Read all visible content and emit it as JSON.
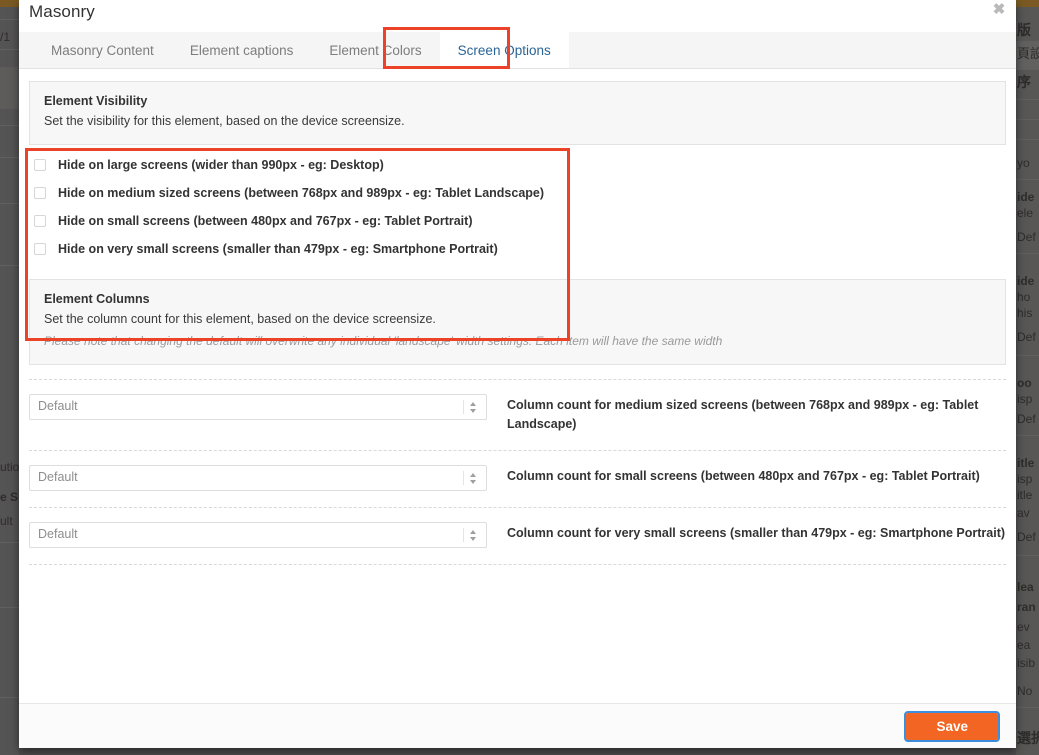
{
  "backdrop": {
    "top_bar_color": "#7a5a22",
    "left_fragments": [
      "/1",
      "utio",
      "e S",
      "ult"
    ],
    "right_fragments": [
      "版",
      "頁設",
      "序",
      "yo",
      "ide",
      "ele",
      "Def",
      "ide",
      "ho",
      "his",
      "Def",
      "oo",
      "isp",
      "Def",
      "itle",
      "isp",
      "itle",
      "av",
      "Def",
      "lea",
      "ran",
      "ev",
      "ea",
      "isib",
      "No",
      "選択"
    ]
  },
  "modal": {
    "title": "Masonry",
    "close_icon": "close-icon",
    "close_glyph": "✖"
  },
  "tabs": [
    {
      "label": "Masonry Content",
      "active": false
    },
    {
      "label": "Element captions",
      "active": false
    },
    {
      "label": "Element Colors",
      "active": false
    },
    {
      "label": "Screen Options",
      "active": true
    }
  ],
  "annotations": {
    "color": "#ec4227",
    "tab_highlight": "Screen Options",
    "section_highlight": "Element Visibility"
  },
  "visibility_panel": {
    "title": "Element Visibility",
    "subtitle": "Set the visibility for this element, based on the device screensize."
  },
  "visibility_options": [
    {
      "label": "Hide on large screens (wider than 990px - eg: Desktop)",
      "checked": false
    },
    {
      "label": "Hide on medium sized screens (between 768px and 989px - eg: Tablet Landscape)",
      "checked": false
    },
    {
      "label": "Hide on small screens (between 480px and 767px - eg: Tablet Portrait)",
      "checked": false
    },
    {
      "label": "Hide on very small screens (smaller than 479px - eg: Smartphone Portrait)",
      "checked": false
    }
  ],
  "columns_panel": {
    "title": "Element Columns",
    "subtitle": "Set the column count for this element, based on the device screensize.",
    "note": "Please note that changing the default will overwrite any individual 'landscape' width settings. Each item will have the same width"
  },
  "column_fields": [
    {
      "value": "Default",
      "description": "Column count for medium sized screens (between 768px and 989px - eg: Tablet Landscape)"
    },
    {
      "value": "Default",
      "description": "Column count for small screens (between 480px and 767px - eg: Tablet Portrait)"
    },
    {
      "value": "Default",
      "description": "Column count for very small screens (smaller than 479px - eg: Smartphone Portrait)"
    }
  ],
  "footer": {
    "save_label": "Save",
    "save_color": "#f26522",
    "focus_ring_color": "#3c8dde"
  }
}
